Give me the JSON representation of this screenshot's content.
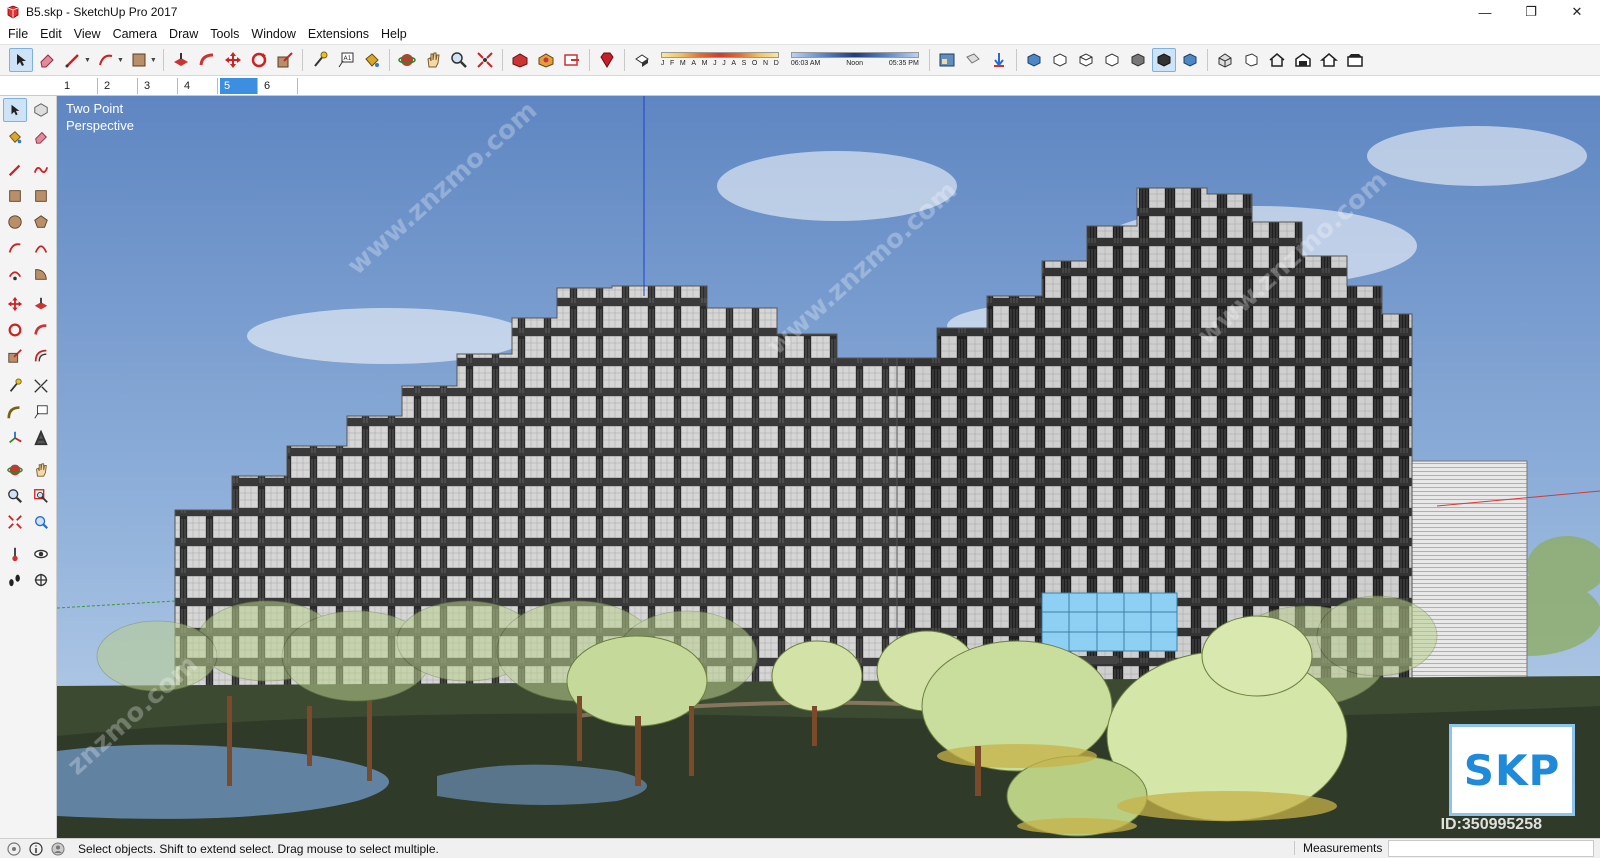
{
  "window": {
    "title": "B5.skp - SketchUp Pro 2017",
    "minimize": "—",
    "maximize": "❐",
    "close": "✕"
  },
  "menu": [
    "File",
    "Edit",
    "View",
    "Camera",
    "Draw",
    "Tools",
    "Window",
    "Extensions",
    "Help"
  ],
  "shadows": {
    "months": [
      "J",
      "F",
      "M",
      "A",
      "M",
      "J",
      "J",
      "A",
      "S",
      "O",
      "N",
      "D"
    ],
    "times": [
      "06:03 AM",
      "Noon",
      "05:35 PM"
    ]
  },
  "scenes": {
    "tabs": [
      "1",
      "2",
      "3",
      "4",
      "5",
      "6"
    ],
    "active_index": 4,
    "active_color": "#3c8fe0"
  },
  "viewport": {
    "camera_label_line1": "Two Point",
    "camera_label_line2": "Perspective",
    "badge_text": "SKP",
    "model_id": "ID:350995258",
    "sky_color": "#6f95cc",
    "building_color": "#c9c9c9",
    "tree_color": "#bfd98a"
  },
  "statusbar": {
    "hint": "Select objects. Shift to extend select. Drag mouse to select multiple.",
    "measurements_label": "Measurements",
    "measurements_value": ""
  },
  "icons": {
    "toolbar": [
      "select-icon",
      "eraser-icon",
      "line-icon",
      "arc-icon",
      "rectangle-icon",
      "push-pull-icon",
      "follow-me-icon",
      "move-icon",
      "rotate-icon",
      "scale-icon",
      "tape-measure-icon",
      "text-icon",
      "paint-bucket-icon",
      "orbit-icon",
      "pan-icon",
      "zoom-icon",
      "zoom-extents-icon",
      "3d-warehouse-icon",
      "extension-warehouse-icon",
      "layout-icon",
      "ruby-icon",
      "shadows-icon",
      "styles-icon",
      "walkthrough-icon",
      "position-camera-icon",
      "iso-view-icon",
      "top-view-icon",
      "front-view-icon",
      "right-view-icon",
      "back-view-icon",
      "left-view-icon"
    ],
    "left": [
      "select-icon",
      "make-component-icon",
      "paint-bucket-icon",
      "eraser-icon",
      "line-icon",
      "freehand-icon",
      "rectangle-icon",
      "rotated-rectangle-icon",
      "circle-icon",
      "polygon-icon",
      "arc-icon",
      "2point-arc-icon",
      "3point-arc-icon",
      "pie-icon",
      "move-icon",
      "push-pull-icon",
      "rotate-icon",
      "follow-me-icon",
      "scale-icon",
      "offset-icon",
      "tape-measure-icon",
      "dimension-icon",
      "protractor-icon",
      "text-icon",
      "axes-icon",
      "3d-text-icon",
      "orbit-icon",
      "pan-icon",
      "zoom-icon",
      "zoom-window-icon",
      "zoom-extents-icon",
      "previous-view-icon",
      "position-camera-icon",
      "look-around-icon",
      "walk-icon",
      "section-plane-icon"
    ]
  }
}
